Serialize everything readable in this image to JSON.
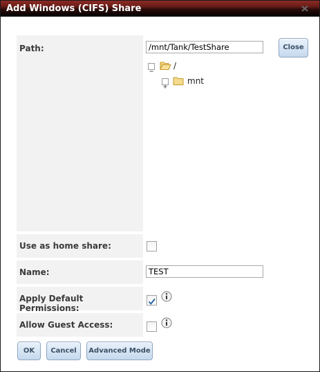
{
  "dialog": {
    "title": "Add Windows (CIFS) Share",
    "close_icon": "close-x-icon"
  },
  "form": {
    "path": {
      "label": "Path:",
      "value": "/mnt/Tank/TestShare",
      "close_button": "Close",
      "tree": {
        "root_label": "/",
        "child_label": "mnt",
        "root_icon": "folder-open-icon",
        "child_icon": "folder-icon"
      }
    },
    "home_share": {
      "label": "Use as home share:",
      "checked": false
    },
    "name": {
      "label": "Name:",
      "value": "TEST"
    },
    "default_permissions": {
      "label": "Apply Default Permissions:",
      "checked": true
    },
    "guest_access": {
      "label": "Allow Guest Access:",
      "checked": false
    }
  },
  "buttons": {
    "ok": "OK",
    "cancel": "Cancel",
    "advanced": "Advanced Mode"
  },
  "colors": {
    "title_bar": "#5a1a15",
    "label_background": "#f2f2f2",
    "button_background": "#d6e5f5"
  }
}
